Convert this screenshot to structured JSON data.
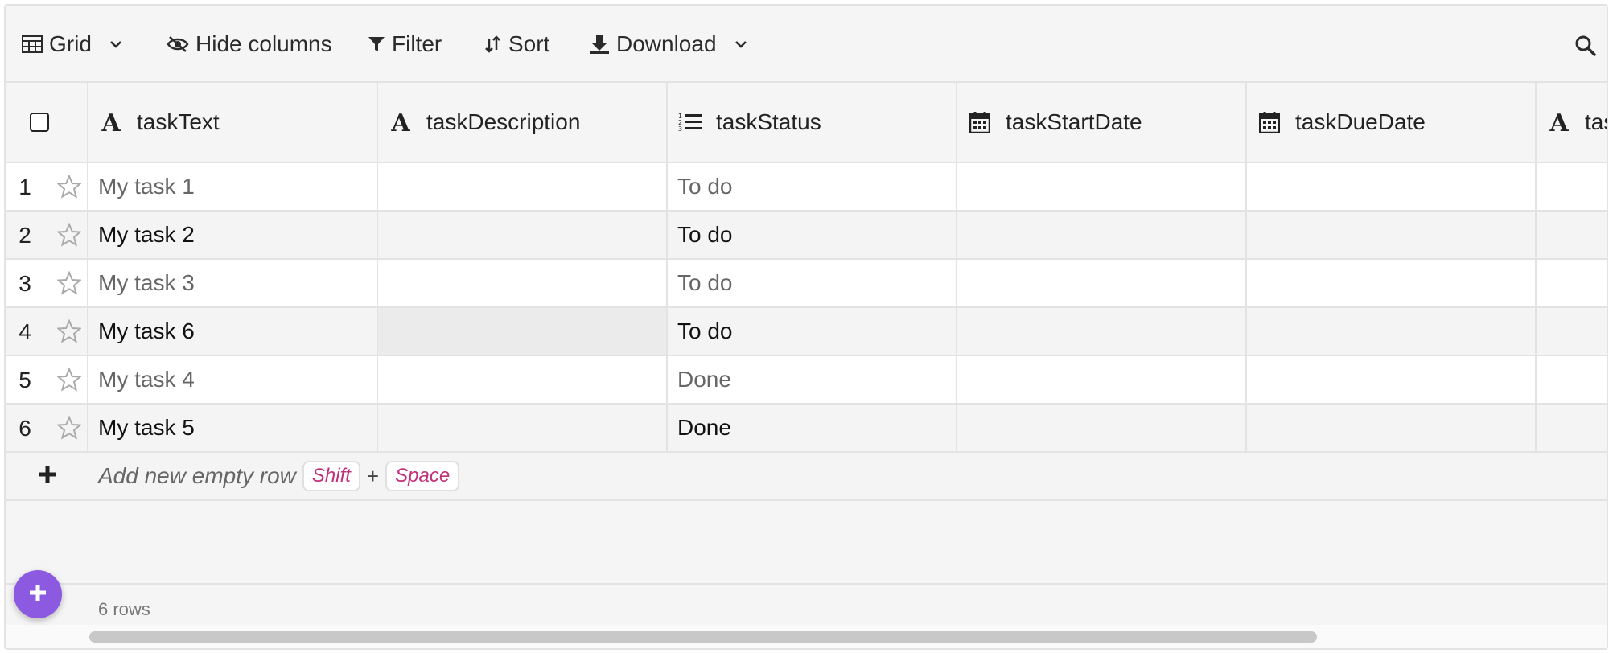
{
  "toolbar": {
    "view_label": "Grid",
    "hide_columns_label": "Hide columns",
    "filter_label": "Filter",
    "sort_label": "Sort",
    "download_label": "Download"
  },
  "columns": [
    {
      "label": "taskText",
      "icon": "text-type-icon"
    },
    {
      "label": "taskDescription",
      "icon": "text-type-icon"
    },
    {
      "label": "taskStatus",
      "icon": "ordered-list-icon"
    },
    {
      "label": "taskStartDate",
      "icon": "calendar-icon"
    },
    {
      "label": "taskDueDate",
      "icon": "calendar-icon"
    },
    {
      "label": "tas",
      "icon": "text-type-icon"
    }
  ],
  "rows": [
    {
      "num": "1",
      "taskText": "My task 1",
      "taskDescription": "",
      "taskStatus": "To do",
      "taskStartDate": "",
      "taskDueDate": ""
    },
    {
      "num": "2",
      "taskText": "My task 2",
      "taskDescription": "",
      "taskStatus": "To do",
      "taskStartDate": "",
      "taskDueDate": ""
    },
    {
      "num": "3",
      "taskText": "My task 3",
      "taskDescription": "",
      "taskStatus": "To do",
      "taskStartDate": "",
      "taskDueDate": ""
    },
    {
      "num": "4",
      "taskText": "My task 6",
      "taskDescription": "",
      "taskStatus": "To do",
      "taskStartDate": "",
      "taskDueDate": ""
    },
    {
      "num": "5",
      "taskText": "My task 4",
      "taskDescription": "",
      "taskStatus": "Done",
      "taskStartDate": "",
      "taskDueDate": ""
    },
    {
      "num": "6",
      "taskText": "My task 5",
      "taskDescription": "",
      "taskStatus": "Done",
      "taskStartDate": "",
      "taskDueDate": ""
    }
  ],
  "add_row": {
    "label": "Add new empty row",
    "key1": "Shift",
    "plus": "+",
    "key2": "Space"
  },
  "footer": {
    "row_count": "6 rows"
  },
  "colors": {
    "accent": "#8c5ae0",
    "kbd_text": "#c2307a"
  }
}
